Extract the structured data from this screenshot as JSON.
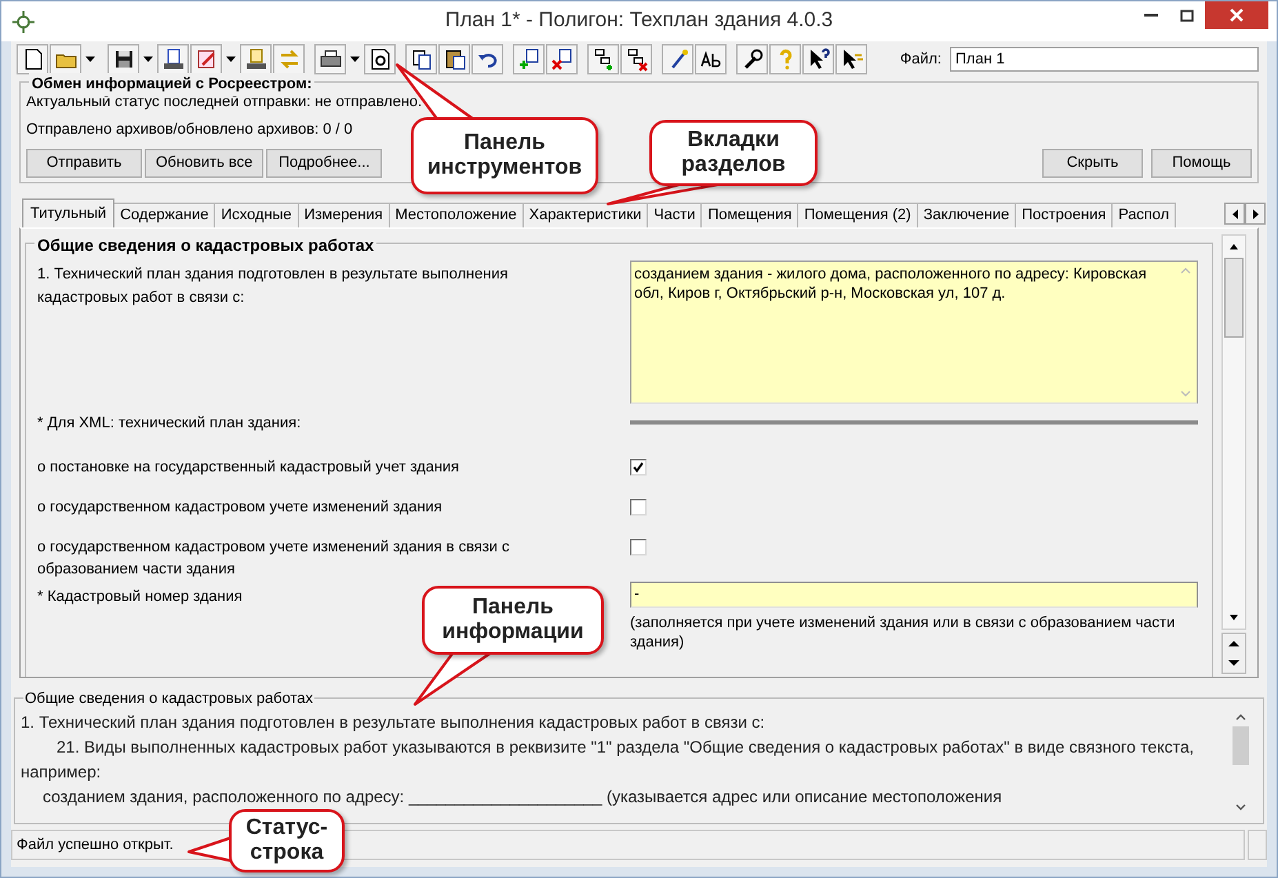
{
  "window": {
    "title": "План 1* - Полигон: Техплан здания 4.0.3"
  },
  "toolbar": {
    "file_label": "Файл:",
    "file_value": "План 1"
  },
  "exchange": {
    "title": "Обмен информацией с Росреестром:",
    "status": "Актуальный статус последней отправки: не отправлено.",
    "counts": "Отправлено архивов/обновлено архивов: 0 / 0",
    "buttons_left": [
      "Отправить",
      "Обновить все",
      "Подробнее..."
    ],
    "buttons_right": [
      "Скрыть",
      "Помощь"
    ]
  },
  "tabs": [
    {
      "label": "Титульный",
      "selected": true
    },
    {
      "label": "Содержание",
      "selected": false
    },
    {
      "label": "Исходные",
      "selected": false
    },
    {
      "label": "Измерения",
      "selected": false
    },
    {
      "label": "Местоположение",
      "selected": false
    },
    {
      "label": "Характеристики",
      "selected": false
    },
    {
      "label": "Части",
      "selected": false
    },
    {
      "label": "Помещения",
      "selected": false
    },
    {
      "label": "Помещения (2)",
      "selected": false
    },
    {
      "label": "Заключение",
      "selected": false
    },
    {
      "label": "Построения",
      "selected": false
    },
    {
      "label": "Распол",
      "selected": false
    }
  ],
  "section": {
    "title": "Общие сведения о кадастровых работах",
    "rows": [
      {
        "kind": "memo",
        "label": "1. Технический план здания подготовлен в результате выполнения кадастровых работ в связи с:",
        "value": "созданием здания - жилого дома, расположенного по адресу: Кировская обл, Киров г, Октябрьский р-н, Московская ул, 107 д."
      },
      {
        "kind": "divider",
        "label": "* Для XML: технический план здания:"
      },
      {
        "kind": "checkbox",
        "label": "о постановке на государственный кадастровый учет здания",
        "checked": true
      },
      {
        "kind": "checkbox",
        "label": "о государственном кадастровом учете изменений здания",
        "checked": false
      },
      {
        "kind": "checkbox",
        "label": "о государственном кадастровом учете изменений здания в связи с образованием части здания",
        "checked": false
      },
      {
        "kind": "input",
        "label": "* Кадастровый номер здания",
        "value": "-",
        "hint": "(заполняется при учете изменений здания или в связи с образованием части здания)"
      }
    ]
  },
  "info_panel": {
    "title": "Общие сведения о кадастровых работах",
    "paragraphs": [
      {
        "kind": "plain",
        "text": "1. Технический план здания подготовлен в результате выполнения кадастровых работ в связи с:"
      },
      {
        "kind": "indented",
        "text": "21. Виды выполненных кадастровых работ указываются в реквизите \"1\" раздела \"Общие сведения о кадастровых работах\" в виде связного текста, например:"
      },
      {
        "kind": "sub",
        "text": "созданием здания, расположенного по адресу: _____________________ (указывается адрес или описание местоположения"
      }
    ]
  },
  "status_bar": {
    "text": "Файл успешно открыт."
  },
  "callouts": [
    {
      "text": "Панель инструментов"
    },
    {
      "text": "Вкладки разделов"
    },
    {
      "text": "Панель информации"
    },
    {
      "text": "Статус-строка"
    }
  ]
}
